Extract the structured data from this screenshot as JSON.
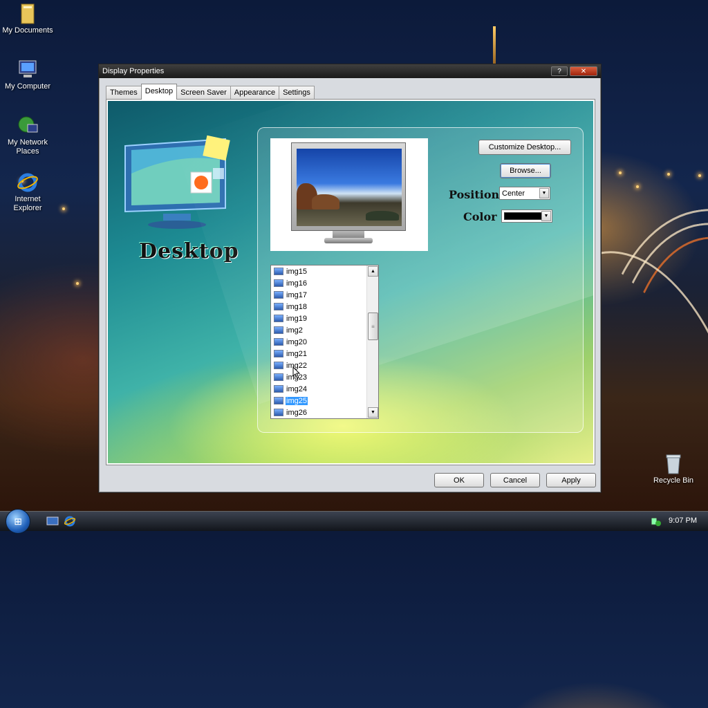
{
  "desktop": {
    "icons": [
      {
        "label": "My Documents"
      },
      {
        "label": "My Computer"
      },
      {
        "label": "My Network Places"
      },
      {
        "label": "Internet Explorer"
      },
      {
        "label": "Recycle Bin"
      }
    ]
  },
  "window": {
    "title": "Display Properties",
    "help_btn": "?",
    "close_btn": "✕",
    "tabs": [
      {
        "label": "Themes"
      },
      {
        "label": "Desktop",
        "active": true
      },
      {
        "label": "Screen Saver"
      },
      {
        "label": "Appearance"
      },
      {
        "label": "Settings"
      }
    ],
    "banner_text": "Desktop",
    "customize_label": "Customize Desktop...",
    "browse_label": "Browse...",
    "position_label": "Position :",
    "position_value": "Center",
    "color_label": "Color :",
    "color_value": "#000000",
    "background_list": [
      "img15",
      "img16",
      "img17",
      "img18",
      "img19",
      "img2",
      "img20",
      "img21",
      "img22",
      "img23",
      "img24",
      "img25",
      "img26"
    ],
    "selected_background": "img25",
    "ok_label": "OK",
    "cancel_label": "Cancel",
    "apply_label": "Apply"
  },
  "taskbar": {
    "clock": "9:07 PM"
  }
}
